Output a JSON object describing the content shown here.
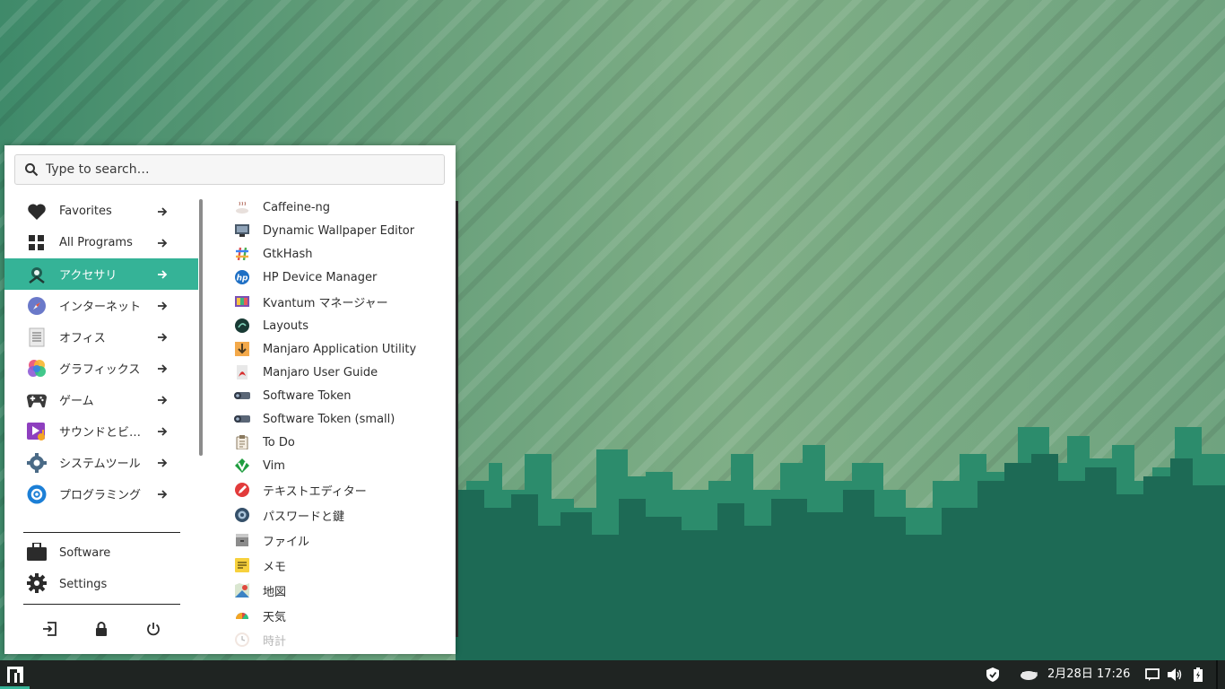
{
  "search": {
    "placeholder": "Type to search…"
  },
  "categories": [
    {
      "label": "Favorites",
      "icon": "heart-icon"
    },
    {
      "label": "All Programs",
      "icon": "grid-icon"
    },
    {
      "label": "アクセサリ",
      "icon": "accessories-icon",
      "active": true
    },
    {
      "label": "インターネット",
      "icon": "compass-icon"
    },
    {
      "label": "オフィス",
      "icon": "document-icon"
    },
    {
      "label": "グラフィックス",
      "icon": "graphics-icon"
    },
    {
      "label": "ゲーム",
      "icon": "gamepad-icon"
    },
    {
      "label": "サウンドとビ…",
      "icon": "multimedia-icon"
    },
    {
      "label": "システムツール",
      "icon": "gear-icon"
    },
    {
      "label": "プログラミング",
      "icon": "programming-icon"
    }
  ],
  "system": [
    {
      "label": "Software",
      "icon": "briefcase-icon"
    },
    {
      "label": "Settings",
      "icon": "settings-gear-icon"
    }
  ],
  "power_buttons": [
    "logout-icon",
    "lock-icon",
    "power-icon"
  ],
  "apps": [
    {
      "label": "Caffeine-ng",
      "icon": "cup-icon"
    },
    {
      "label": "Dynamic Wallpaper Editor",
      "icon": "wallpaper-editor-icon"
    },
    {
      "label": "GtkHash",
      "icon": "hash-icon"
    },
    {
      "label": "HP Device Manager",
      "icon": "hp-icon"
    },
    {
      "label": "Kvantum マネージャー",
      "icon": "kvantum-icon"
    },
    {
      "label": "Layouts",
      "icon": "layouts-icon"
    },
    {
      "label": "Manjaro Application Utility",
      "icon": "download-icon"
    },
    {
      "label": "Manjaro User Guide",
      "icon": "pdf-icon"
    },
    {
      "label": "Software Token",
      "icon": "token-icon"
    },
    {
      "label": "Software Token (small)",
      "icon": "token-small-icon"
    },
    {
      "label": "To Do",
      "icon": "clipboard-icon"
    },
    {
      "label": "Vim",
      "icon": "vim-icon"
    },
    {
      "label": "テキストエディター",
      "icon": "text-editor-icon"
    },
    {
      "label": "パスワードと鍵",
      "icon": "password-icon"
    },
    {
      "label": "ファイル",
      "icon": "files-icon"
    },
    {
      "label": "メモ",
      "icon": "notes-icon"
    },
    {
      "label": "地図",
      "icon": "map-icon"
    },
    {
      "label": "天気",
      "icon": "weather-icon"
    },
    {
      "label": "時計",
      "icon": "clock-icon"
    }
  ],
  "taskbar": {
    "clock": "2月28日 17:26",
    "tray": [
      "shield-icon",
      "caffeine-tray-icon",
      "chat-icon",
      "volume-icon",
      "battery-icon"
    ]
  },
  "colors": {
    "accent": "#35b397",
    "taskbar": "#1f2422",
    "menu_bg": "#ffffff"
  }
}
